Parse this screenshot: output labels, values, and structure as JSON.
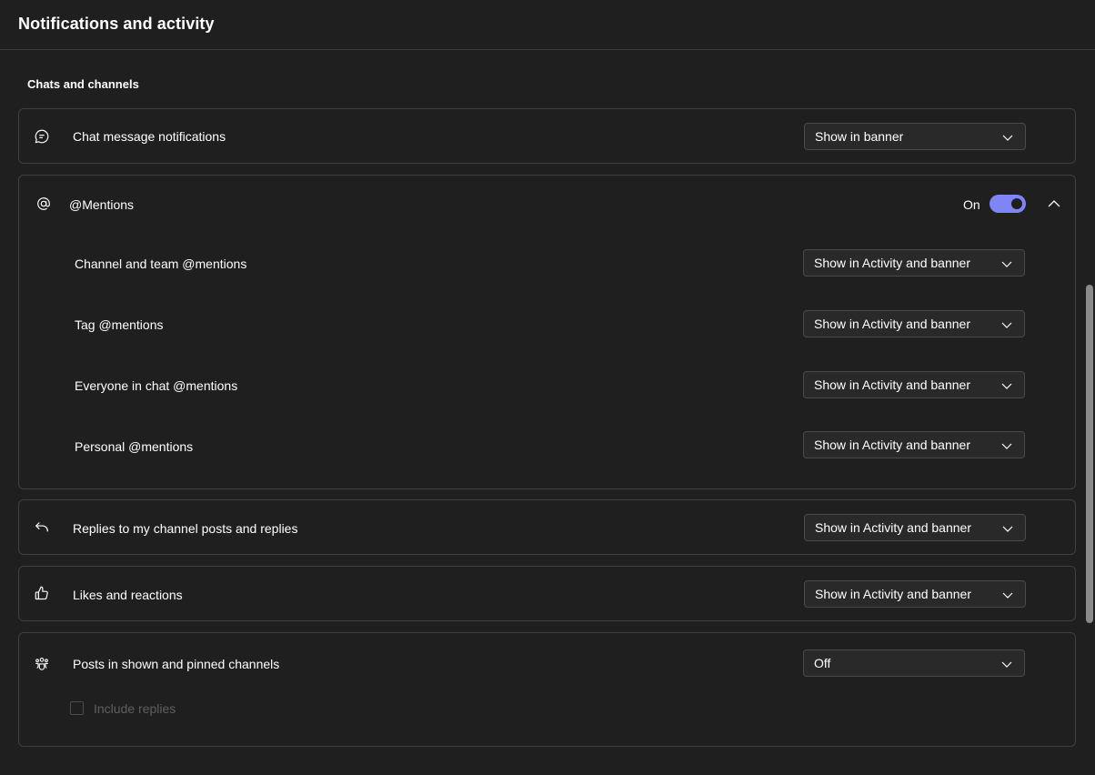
{
  "header": {
    "title": "Notifications and activity"
  },
  "section": {
    "title": "Chats and channels"
  },
  "chat": {
    "icon": "chat-bubble-icon",
    "label": "Chat message notifications",
    "value": "Show in banner"
  },
  "mentions": {
    "icon": "at-sign-icon",
    "label": "@Mentions",
    "toggle_label": "On",
    "toggle_on": true,
    "items": [
      {
        "label": "Channel and team @mentions",
        "value": "Show in Activity and banner"
      },
      {
        "label": "Tag @mentions",
        "value": "Show in Activity and banner"
      },
      {
        "label": "Everyone in chat @mentions",
        "value": "Show in Activity and banner"
      },
      {
        "label": "Personal @mentions",
        "value": "Show in Activity and banner"
      }
    ]
  },
  "replies": {
    "icon": "reply-arrow-icon",
    "label": "Replies to my channel posts and replies",
    "value": "Show in Activity and banner"
  },
  "likes": {
    "icon": "thumbs-up-icon",
    "label": "Likes and reactions",
    "value": "Show in Activity and banner"
  },
  "posts": {
    "icon": "people-team-icon",
    "label": "Posts in shown and pinned channels",
    "value": "Off",
    "include_replies_label": "Include replies",
    "include_replies_checked": false
  },
  "colors": {
    "background": "#1f1f1f",
    "toggle_accent": "#7f85f5",
    "border": "#404040",
    "disabled_text": "#5f5f5f"
  }
}
